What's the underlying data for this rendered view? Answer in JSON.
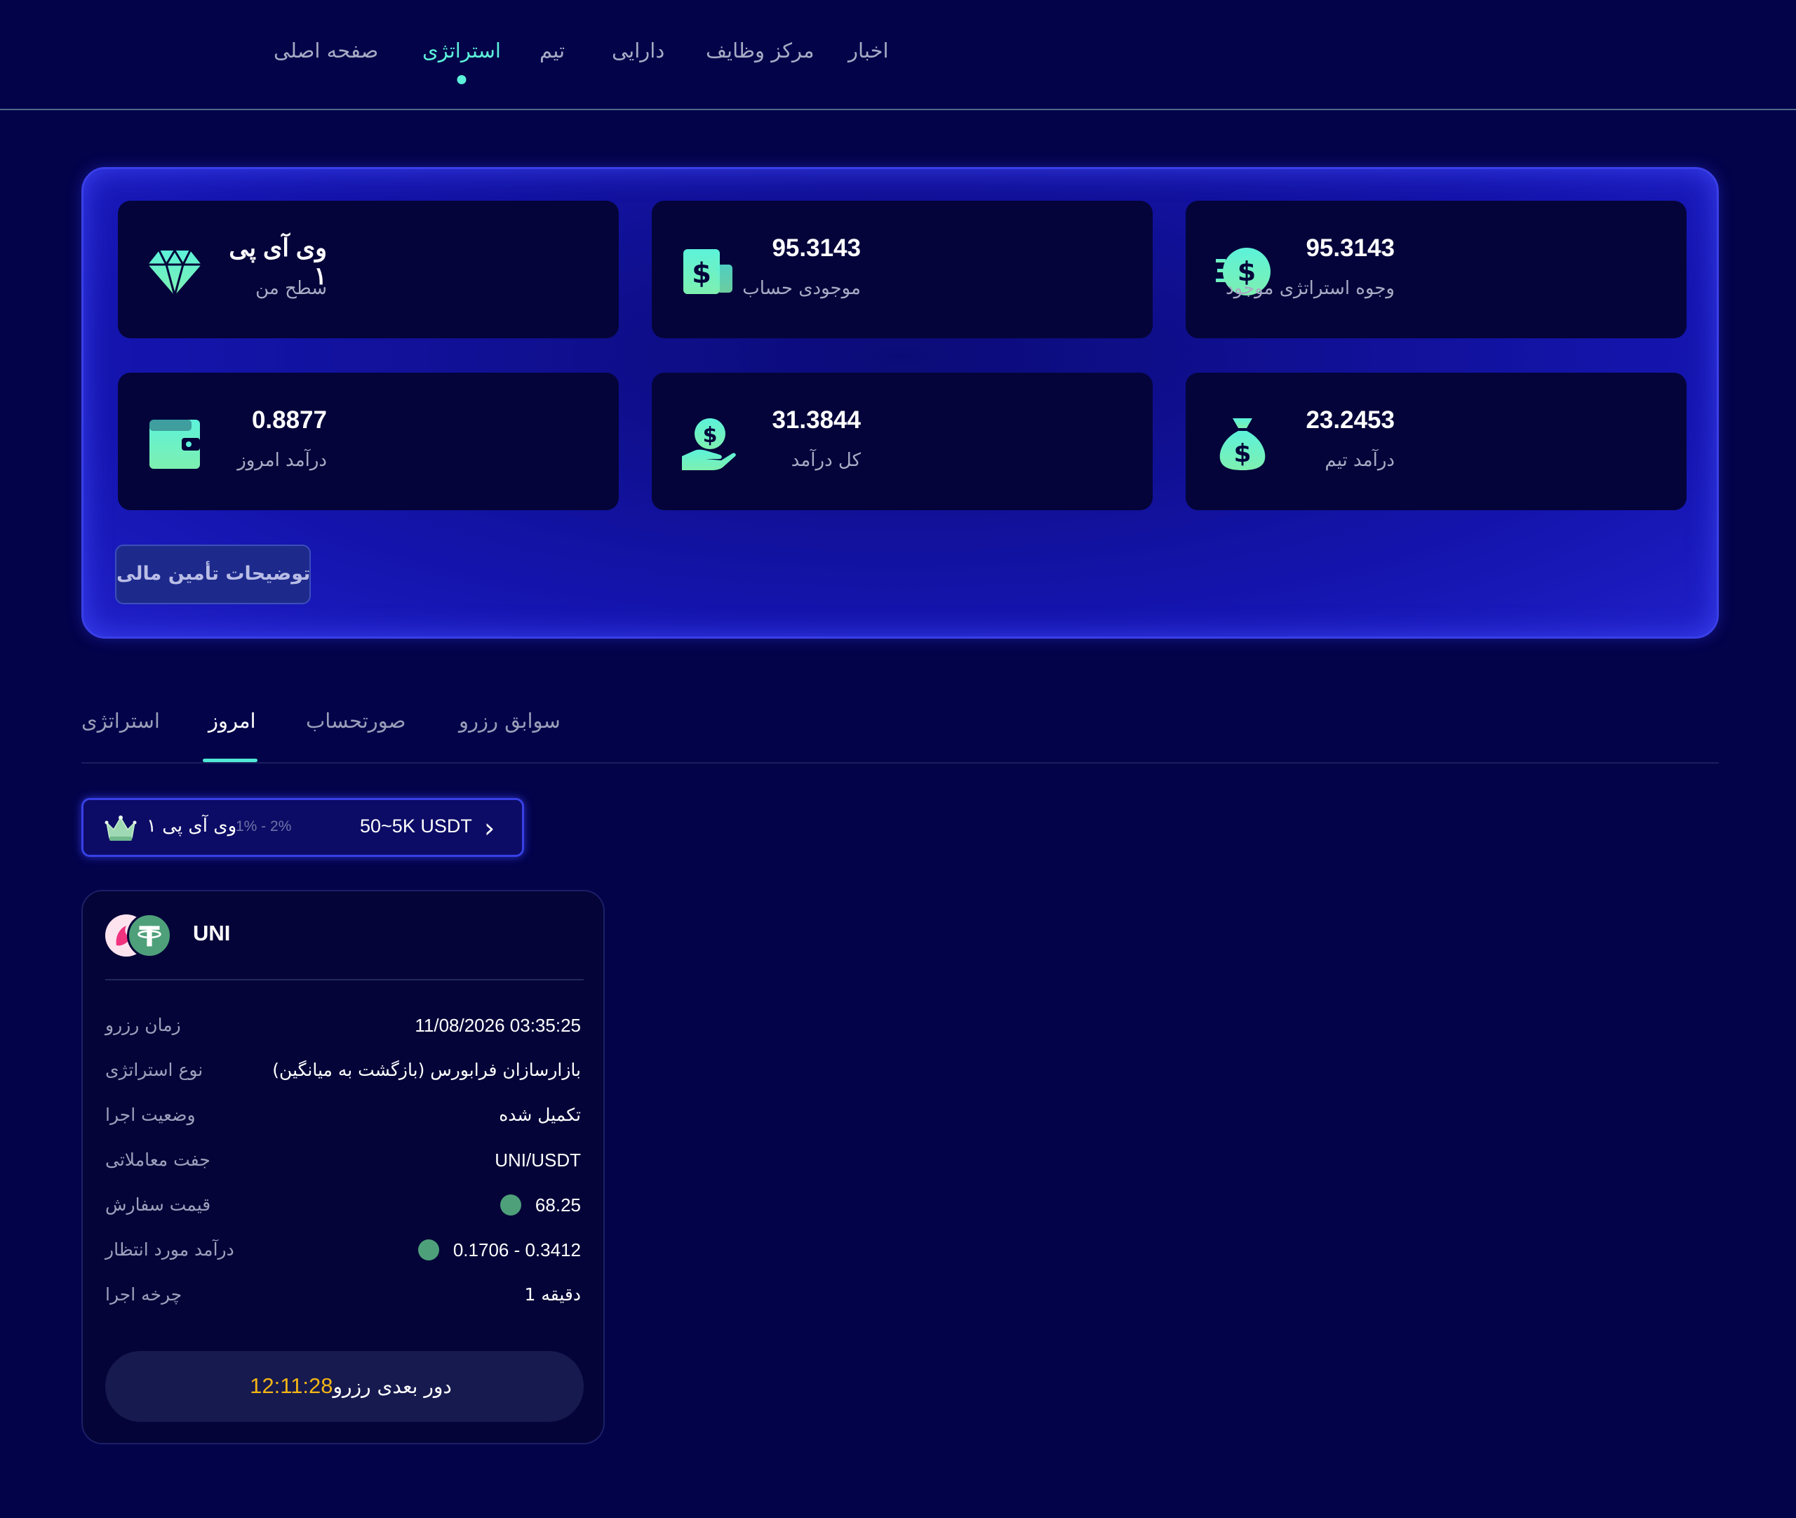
{
  "nav": {
    "items": [
      {
        "label": "اخبار"
      },
      {
        "label": "مرکز وظایف"
      },
      {
        "label": "دارایی"
      },
      {
        "label": "تیم"
      },
      {
        "label": "استراتژی",
        "active": true
      },
      {
        "label": "صفحه اصلی"
      }
    ]
  },
  "stats": [
    {
      "value": "95.3143",
      "label": "وجوه استراتژی موجود",
      "icon": "dollar-coin-icon"
    },
    {
      "value": "95.3143",
      "label": "موجودی حساب",
      "icon": "dollar-wallet-icon"
    },
    {
      "value": "وی آی پی ۱",
      "label": "سطح من",
      "icon": "diamond-icon"
    },
    {
      "value": "23.2453",
      "label": "درآمد تیم",
      "icon": "money-bag-icon"
    },
    {
      "value": "31.3844",
      "label": "کل درآمد",
      "icon": "hand-coin-icon"
    },
    {
      "value": "0.8877",
      "label": "درآمد امروز",
      "icon": "wallet-icon"
    }
  ],
  "funding_button": "توضیحات تأمین مالی",
  "tabs": [
    {
      "label": "استراتژی"
    },
    {
      "label": "امروز",
      "active": true
    },
    {
      "label": "صورتحساب"
    },
    {
      "label": "سوابق رزرو"
    }
  ],
  "vip_bar": {
    "range": "50~5K USDT",
    "percent": "1% - 2%",
    "name": "وی آی پی ۱",
    "icon": "crown-icon"
  },
  "order": {
    "pair": "UNI",
    "rows": [
      {
        "label": "زمان رزرو",
        "value": "11/08/2026 03:35:25"
      },
      {
        "label": "نوع استراتژی",
        "value": "بازارسازان فرابورس (بازگشت به میانگین)"
      },
      {
        "label": "وضعیت اجرا",
        "value": "تکمیل شده"
      },
      {
        "label": "جفت معاملاتی",
        "value": "UNI/USDT"
      },
      {
        "label": "قیمت سفارش",
        "value": "68.25"
      },
      {
        "label": "درآمد مورد انتظار",
        "value": "0.1706 - 0.3412"
      },
      {
        "label": "چرخه اجرا",
        "value": "دقیقه 1"
      }
    ],
    "next_round_label": "دور بعدی رزرو",
    "countdown": "12:11:28"
  },
  "colors": {
    "background": "#03034a",
    "accent": "#5cf2da",
    "panel_border": "#3a3fe8",
    "countdown": "#f2b515",
    "usdt_green": "#4ea07a"
  }
}
